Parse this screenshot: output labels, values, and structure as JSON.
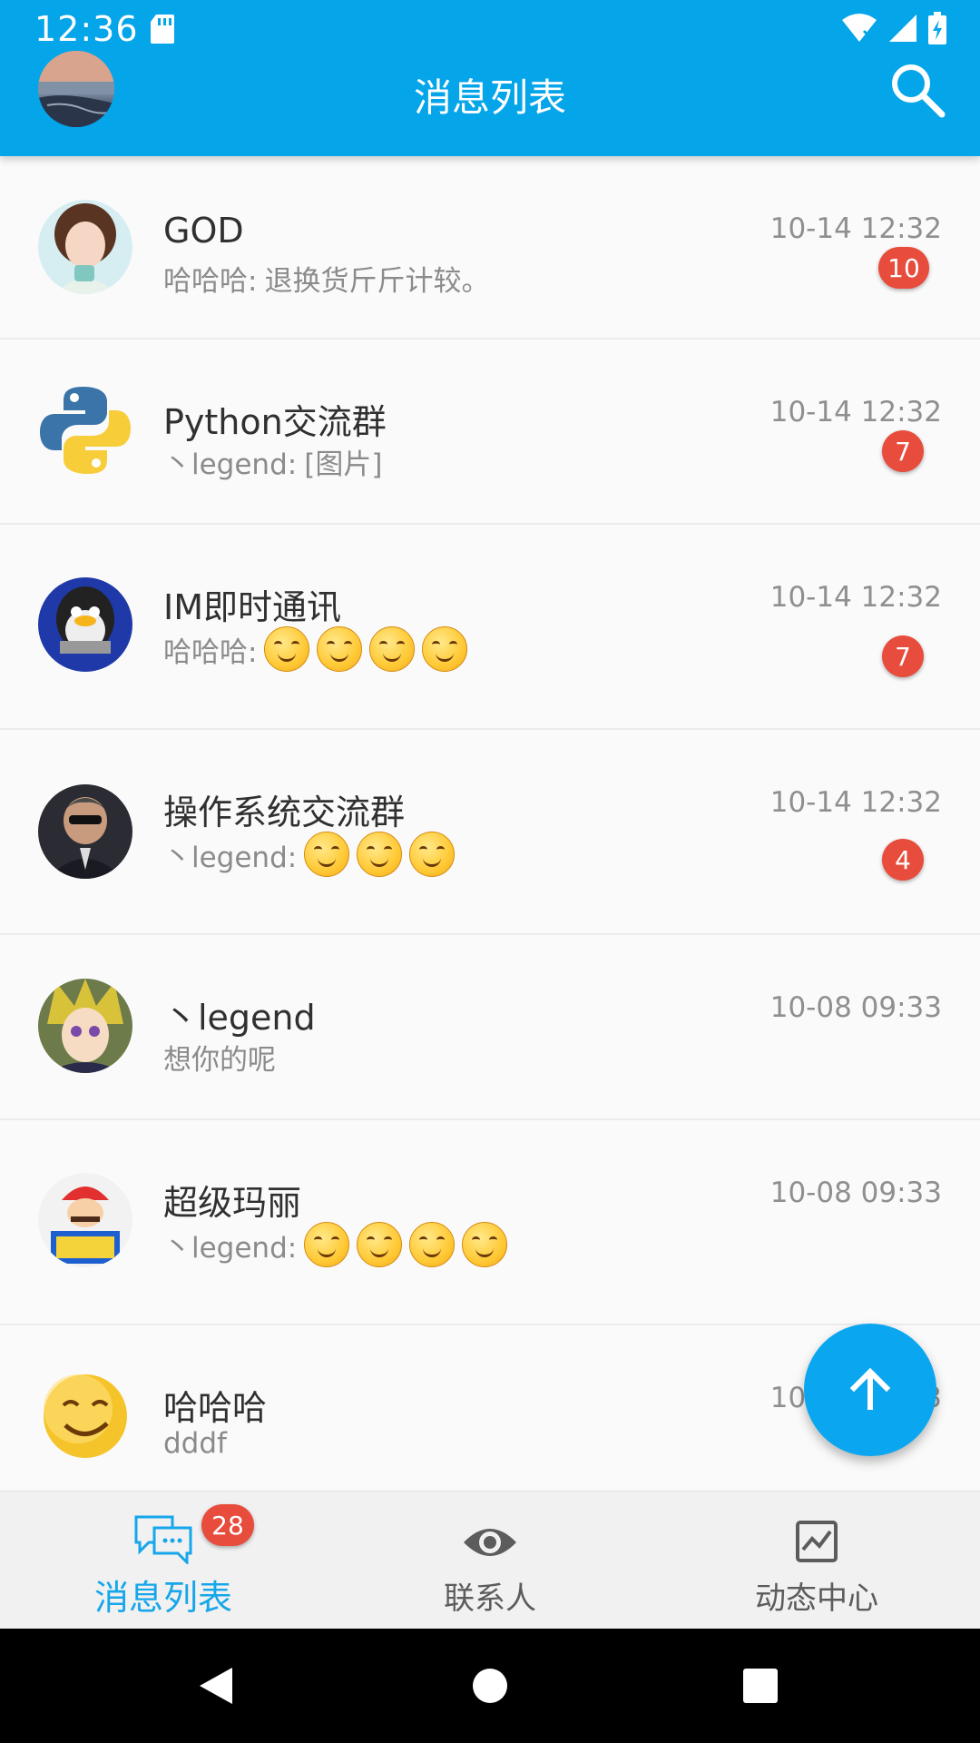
{
  "status_bar": {
    "time": "12:36"
  },
  "app_bar": {
    "title": "消息列表"
  },
  "conversations": [
    {
      "title": "GOD",
      "message_sender": "哈哈哈:",
      "message_text": "退换货斤斤计较。",
      "time": "10-14 12:32",
      "unread": "10",
      "emoji_count": 0,
      "avatar": "girl"
    },
    {
      "title": "Python交流群",
      "message_sender": "丶legend:",
      "message_text": "[图片]",
      "time": "10-14 12:32",
      "unread": "7",
      "emoji_count": 0,
      "avatar": "python"
    },
    {
      "title": "IM即时通讯",
      "message_sender": "哈哈哈:",
      "message_text": "",
      "time": "10-14 12:32",
      "unread": "7",
      "emoji_count": 4,
      "avatar": "penguin"
    },
    {
      "title": "操作系统交流群",
      "message_sender": "丶legend:",
      "message_text": "",
      "time": "10-14 12:32",
      "unread": "4",
      "emoji_count": 3,
      "avatar": "man"
    },
    {
      "title": "丶legend",
      "message_sender": "",
      "message_text": "想你的呢",
      "time": "10-08 09:33",
      "unread": "",
      "emoji_count": 0,
      "avatar": "anime"
    },
    {
      "title": "超级玛丽",
      "message_sender": "丶legend:",
      "message_text": "",
      "time": "10-08 09:33",
      "unread": "",
      "emoji_count": 4,
      "avatar": "mario"
    },
    {
      "title": "哈哈哈",
      "message_sender": "",
      "message_text": "dddf",
      "time": "10-08 09:33",
      "unread": "",
      "emoji_count": 0,
      "avatar": "smiley"
    }
  ],
  "bottom_nav": {
    "items": [
      {
        "label": "消息列表",
        "icon": "chat-icon",
        "badge": "28",
        "active": true
      },
      {
        "label": "联系人",
        "icon": "eye-icon",
        "badge": "",
        "active": false
      },
      {
        "label": "动态中心",
        "icon": "chart-icon",
        "badge": "",
        "active": false
      }
    ]
  },
  "colors": {
    "primary": "#05a5ea",
    "badge": "#e74c3c",
    "active_tab": "#16a6ea"
  }
}
